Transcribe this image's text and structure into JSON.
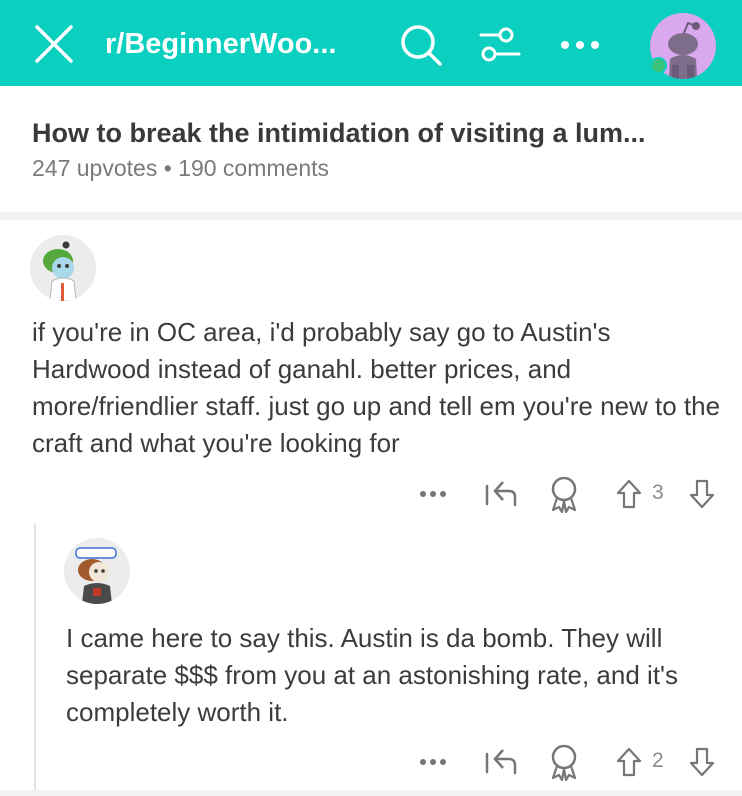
{
  "header": {
    "subreddit_title": "r/BeginnerWoo...",
    "background_color": "#0bcfbf",
    "icons": [
      "close-icon",
      "search-icon",
      "filter-icon",
      "more-icon",
      "snoo-avatar-icon"
    ]
  },
  "post": {
    "title": "How to break the intimidation of visiting a lum...",
    "upvotes": "247 upvotes",
    "dot": "•",
    "comments": "190 comments"
  },
  "comments": [
    {
      "body": "if you're in OC area, i'd probably say go to Austin's Hardwood instead of ganahl. better prices, and more/friendlier staff. just go up and tell em you're new to the craft and what you're looking for",
      "score": "3"
    },
    {
      "body": "I came here to say this. Austin is da bomb. They will separate $$$ from you at an astonishing rate, and it's completely worth it.",
      "score": "2"
    }
  ]
}
